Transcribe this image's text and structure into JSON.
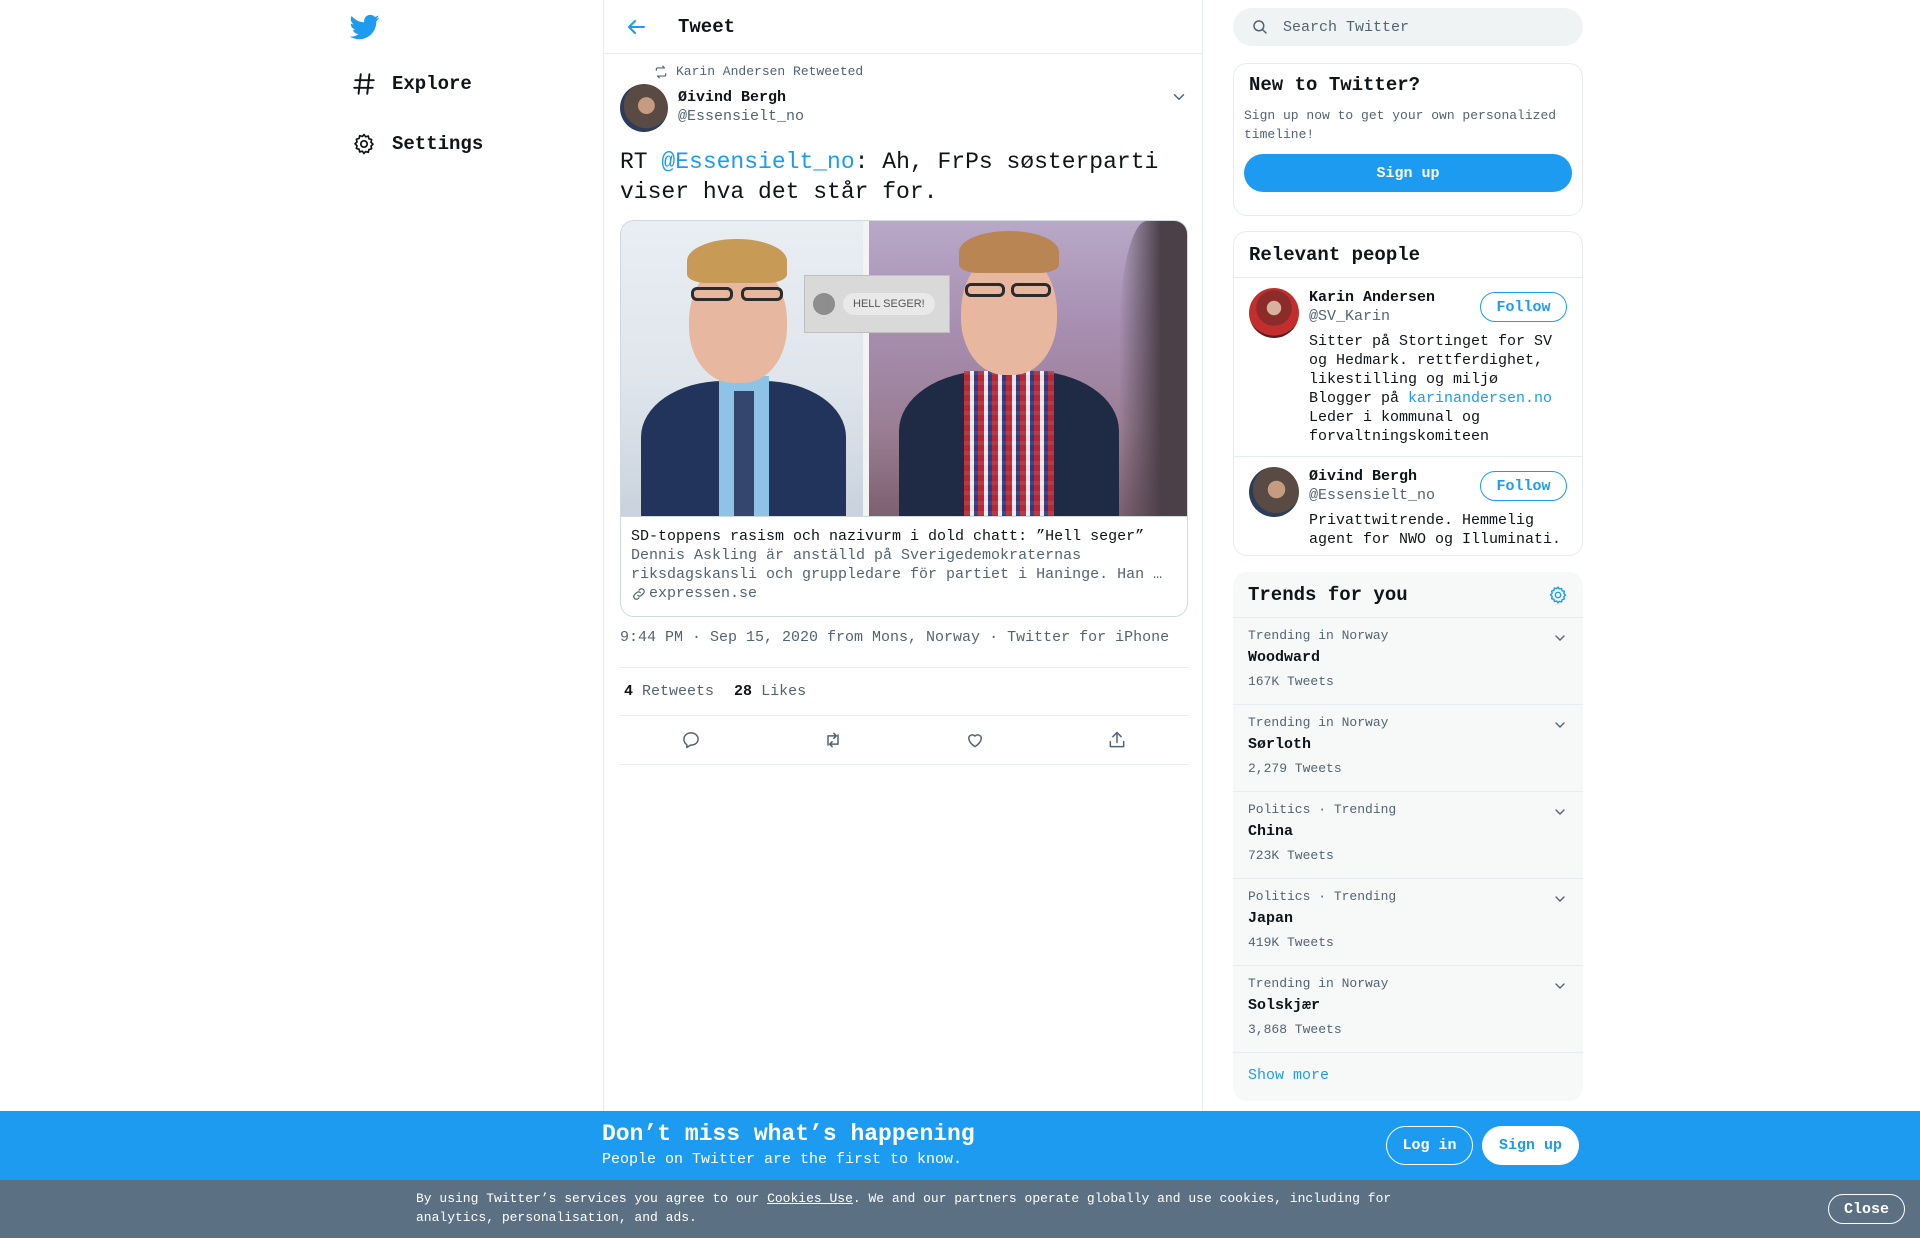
{
  "colors": {
    "accent": "#1d9bf0",
    "text": "#0f1419",
    "secondary": "#536471",
    "cookie_bg": "#5b7083"
  },
  "nav": {
    "logo_icon": "twitter-bird-icon",
    "items": [
      {
        "label": "Explore",
        "icon": "hashtag-icon"
      },
      {
        "label": "Settings",
        "icon": "gear-icon"
      }
    ]
  },
  "header": {
    "title": "Tweet",
    "back_icon": "arrow-left-icon"
  },
  "tweet": {
    "retweeted_by": "Karin Andersen Retweeted",
    "author_name": "Øivind Bergh",
    "author_handle": "@Essensielt_no",
    "text_prefix": "RT ",
    "mention": "@Essensielt_no",
    "text_rest": ": Ah, FrPs søsterparti viser hva det står for.",
    "card": {
      "badge_text": "HELL SEGER!",
      "title": "SD-toppens rasism och nazivurm i dold chatt: ”Hell seger”",
      "description": "Dennis Askling är anställd på Sverigedemokraternas riksdagskansli och gruppledare för partiet i Haninge. Han …",
      "domain": "expressen.se"
    },
    "meta_time": "9:44 PM · Sep 15, 2020 from Mons, Norway",
    "meta_sep": " · ",
    "meta_client": "Twitter for iPhone",
    "retweets_count": "4",
    "retweets_label": "Retweets",
    "likes_count": "28",
    "likes_label": "Likes"
  },
  "sidebar": {
    "search_placeholder": "Search Twitter",
    "new_box": {
      "title": "New to Twitter?",
      "subtitle": "Sign up now to get your own personalized timeline!",
      "button": "Sign up"
    },
    "people": {
      "title": "Relevant people",
      "items": [
        {
          "name": "Karin Andersen",
          "handle": "@SV_Karin",
          "bio_before": "Sitter på Stortinget for SV og Hedmark. rettferdighet, likestilling og miljø Blogger på ",
          "bio_link": "karinandersen.no",
          "bio_after": " Leder i kommunal og forvaltningskomiteen",
          "follow": "Follow"
        },
        {
          "name": "Øivind Bergh",
          "handle": "@Essensielt_no",
          "bio": "Privattwitrende. Hemmelig agent for NWO og Illuminati.",
          "follow": "Follow"
        }
      ]
    },
    "trends": {
      "title": "Trends for you",
      "items": [
        {
          "context": "Trending in Norway",
          "name": "Woodward",
          "count": "167K Tweets"
        },
        {
          "context": "Trending in Norway",
          "name": "Sørloth",
          "count": "2,279 Tweets"
        },
        {
          "context": "Politics · Trending",
          "name": "China",
          "count": "723K Tweets"
        },
        {
          "context": "Politics · Trending",
          "name": "Japan",
          "count": "419K Tweets"
        },
        {
          "context": "Trending in Norway",
          "name": "Solskjær",
          "count": "3,868 Tweets"
        }
      ],
      "show_more": "Show more"
    }
  },
  "banner": {
    "title": "Don’t miss what’s happening",
    "subtitle": "People on Twitter are the first to know.",
    "login": "Log in",
    "signup": "Sign up"
  },
  "cookie": {
    "text_before": "By using Twitter’s services you agree to our ",
    "link": "Cookies Use",
    "text_after": ". We and our partners operate globally and use cookies, including for analytics, personalisation, and ads.",
    "close": "Close"
  }
}
